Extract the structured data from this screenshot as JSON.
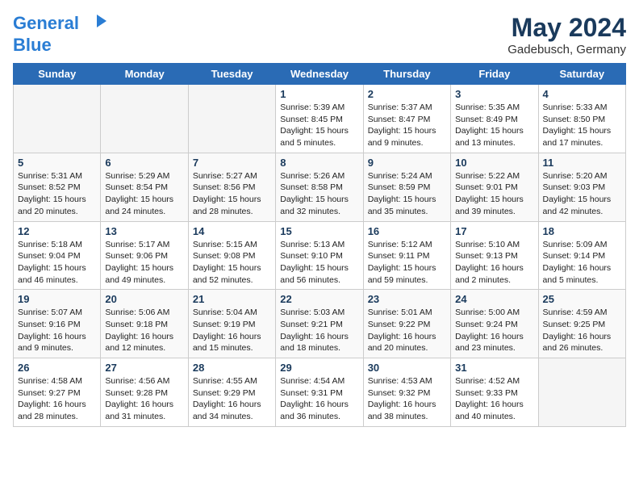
{
  "header": {
    "logo_line1": "General",
    "logo_line2": "Blue",
    "month_year": "May 2024",
    "location": "Gadebusch, Germany"
  },
  "days": [
    "Sunday",
    "Monday",
    "Tuesday",
    "Wednesday",
    "Thursday",
    "Friday",
    "Saturday"
  ],
  "weeks": [
    [
      {
        "date": "",
        "info": ""
      },
      {
        "date": "",
        "info": ""
      },
      {
        "date": "",
        "info": ""
      },
      {
        "date": "1",
        "info": "Sunrise: 5:39 AM\nSunset: 8:45 PM\nDaylight: 15 hours\nand 5 minutes."
      },
      {
        "date": "2",
        "info": "Sunrise: 5:37 AM\nSunset: 8:47 PM\nDaylight: 15 hours\nand 9 minutes."
      },
      {
        "date": "3",
        "info": "Sunrise: 5:35 AM\nSunset: 8:49 PM\nDaylight: 15 hours\nand 13 minutes."
      },
      {
        "date": "4",
        "info": "Sunrise: 5:33 AM\nSunset: 8:50 PM\nDaylight: 15 hours\nand 17 minutes."
      }
    ],
    [
      {
        "date": "5",
        "info": "Sunrise: 5:31 AM\nSunset: 8:52 PM\nDaylight: 15 hours\nand 20 minutes."
      },
      {
        "date": "6",
        "info": "Sunrise: 5:29 AM\nSunset: 8:54 PM\nDaylight: 15 hours\nand 24 minutes."
      },
      {
        "date": "7",
        "info": "Sunrise: 5:27 AM\nSunset: 8:56 PM\nDaylight: 15 hours\nand 28 minutes."
      },
      {
        "date": "8",
        "info": "Sunrise: 5:26 AM\nSunset: 8:58 PM\nDaylight: 15 hours\nand 32 minutes."
      },
      {
        "date": "9",
        "info": "Sunrise: 5:24 AM\nSunset: 8:59 PM\nDaylight: 15 hours\nand 35 minutes."
      },
      {
        "date": "10",
        "info": "Sunrise: 5:22 AM\nSunset: 9:01 PM\nDaylight: 15 hours\nand 39 minutes."
      },
      {
        "date": "11",
        "info": "Sunrise: 5:20 AM\nSunset: 9:03 PM\nDaylight: 15 hours\nand 42 minutes."
      }
    ],
    [
      {
        "date": "12",
        "info": "Sunrise: 5:18 AM\nSunset: 9:04 PM\nDaylight: 15 hours\nand 46 minutes."
      },
      {
        "date": "13",
        "info": "Sunrise: 5:17 AM\nSunset: 9:06 PM\nDaylight: 15 hours\nand 49 minutes."
      },
      {
        "date": "14",
        "info": "Sunrise: 5:15 AM\nSunset: 9:08 PM\nDaylight: 15 hours\nand 52 minutes."
      },
      {
        "date": "15",
        "info": "Sunrise: 5:13 AM\nSunset: 9:10 PM\nDaylight: 15 hours\nand 56 minutes."
      },
      {
        "date": "16",
        "info": "Sunrise: 5:12 AM\nSunset: 9:11 PM\nDaylight: 15 hours\nand 59 minutes."
      },
      {
        "date": "17",
        "info": "Sunrise: 5:10 AM\nSunset: 9:13 PM\nDaylight: 16 hours\nand 2 minutes."
      },
      {
        "date": "18",
        "info": "Sunrise: 5:09 AM\nSunset: 9:14 PM\nDaylight: 16 hours\nand 5 minutes."
      }
    ],
    [
      {
        "date": "19",
        "info": "Sunrise: 5:07 AM\nSunset: 9:16 PM\nDaylight: 16 hours\nand 9 minutes."
      },
      {
        "date": "20",
        "info": "Sunrise: 5:06 AM\nSunset: 9:18 PM\nDaylight: 16 hours\nand 12 minutes."
      },
      {
        "date": "21",
        "info": "Sunrise: 5:04 AM\nSunset: 9:19 PM\nDaylight: 16 hours\nand 15 minutes."
      },
      {
        "date": "22",
        "info": "Sunrise: 5:03 AM\nSunset: 9:21 PM\nDaylight: 16 hours\nand 18 minutes."
      },
      {
        "date": "23",
        "info": "Sunrise: 5:01 AM\nSunset: 9:22 PM\nDaylight: 16 hours\nand 20 minutes."
      },
      {
        "date": "24",
        "info": "Sunrise: 5:00 AM\nSunset: 9:24 PM\nDaylight: 16 hours\nand 23 minutes."
      },
      {
        "date": "25",
        "info": "Sunrise: 4:59 AM\nSunset: 9:25 PM\nDaylight: 16 hours\nand 26 minutes."
      }
    ],
    [
      {
        "date": "26",
        "info": "Sunrise: 4:58 AM\nSunset: 9:27 PM\nDaylight: 16 hours\nand 28 minutes."
      },
      {
        "date": "27",
        "info": "Sunrise: 4:56 AM\nSunset: 9:28 PM\nDaylight: 16 hours\nand 31 minutes."
      },
      {
        "date": "28",
        "info": "Sunrise: 4:55 AM\nSunset: 9:29 PM\nDaylight: 16 hours\nand 34 minutes."
      },
      {
        "date": "29",
        "info": "Sunrise: 4:54 AM\nSunset: 9:31 PM\nDaylight: 16 hours\nand 36 minutes."
      },
      {
        "date": "30",
        "info": "Sunrise: 4:53 AM\nSunset: 9:32 PM\nDaylight: 16 hours\nand 38 minutes."
      },
      {
        "date": "31",
        "info": "Sunrise: 4:52 AM\nSunset: 9:33 PM\nDaylight: 16 hours\nand 40 minutes."
      },
      {
        "date": "",
        "info": ""
      }
    ]
  ]
}
